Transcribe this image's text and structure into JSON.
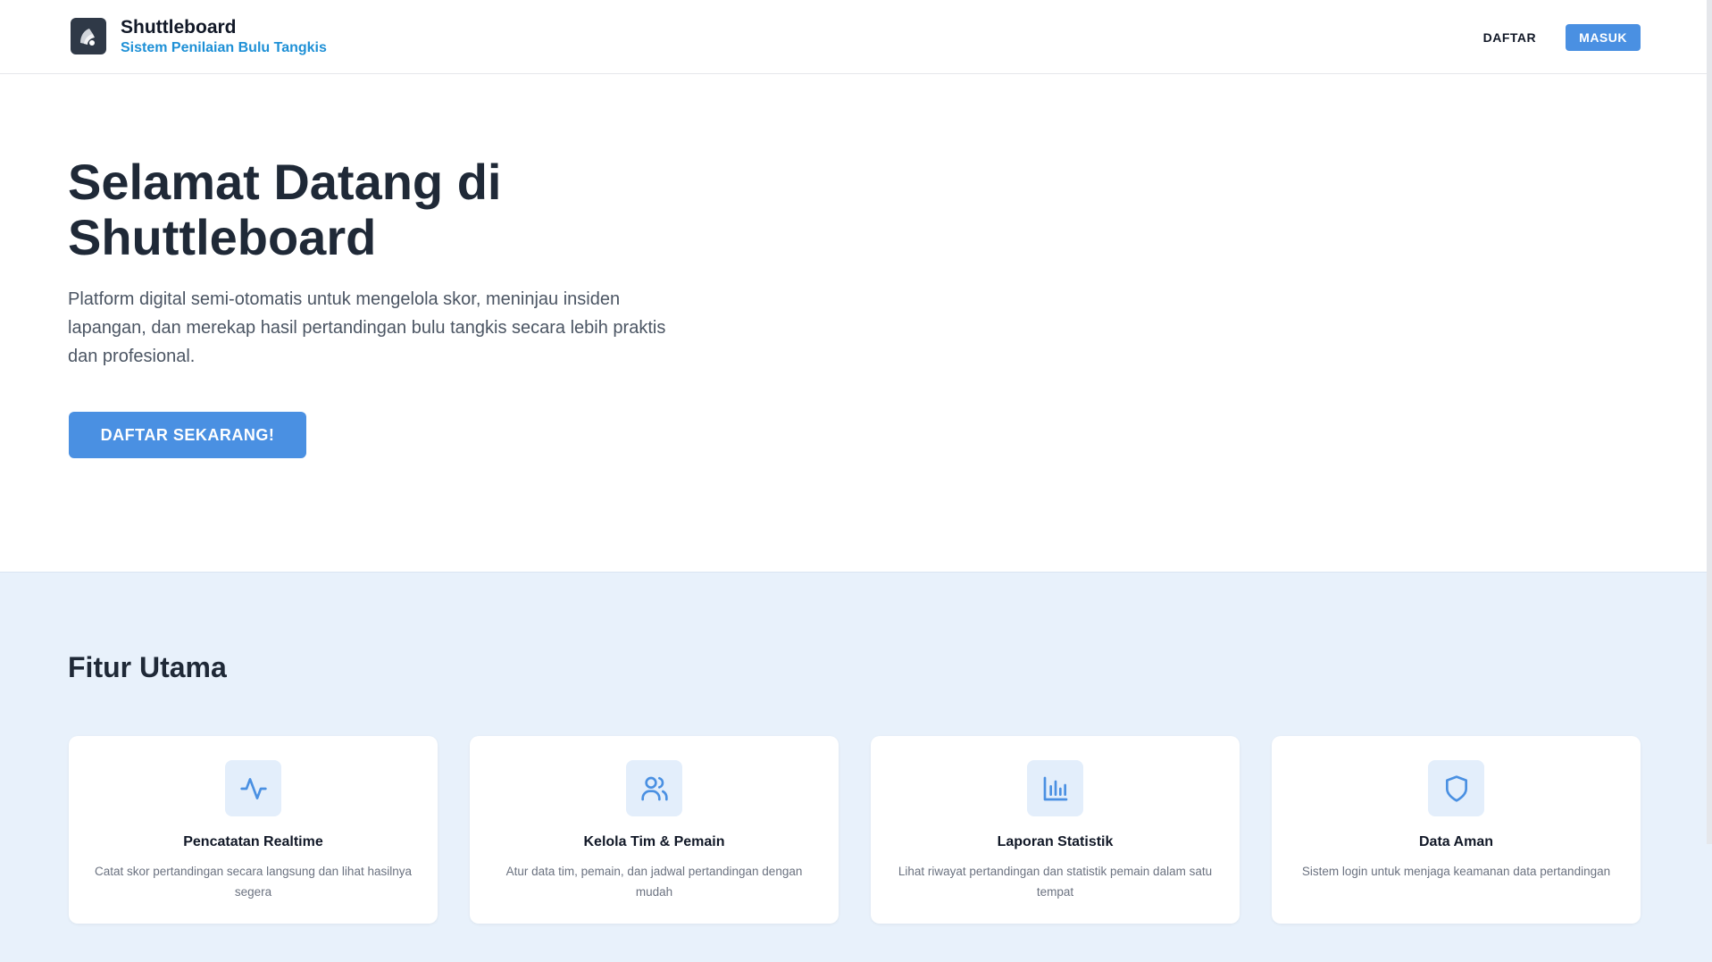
{
  "brand": {
    "title": "Shuttleboard",
    "subtitle": "Sistem Penilaian Bulu Tangkis",
    "logo_icon": "shuttlecock-icon"
  },
  "nav": {
    "daftar_label": "DAFTAR",
    "masuk_label": "MASUK"
  },
  "hero": {
    "title": "Selamat Datang di Shuttleboard",
    "description": "Platform digital semi-otomatis untuk mengelola skor, meninjau insiden lapangan, dan merekap hasil pertandingan bulu tangkis secara lebih praktis dan profesional.",
    "cta_label": "DAFTAR SEKARANG!"
  },
  "features": {
    "title": "Fitur Utama",
    "items": [
      {
        "icon": "activity-icon",
        "title": "Pencatatan Realtime",
        "description": "Catat skor pertandingan secara langsung dan lihat hasilnya segera"
      },
      {
        "icon": "users-icon",
        "title": "Kelola Tim & Pemain",
        "description": "Atur data tim, pemain, dan jadwal pertandingan dengan mudah"
      },
      {
        "icon": "bar-chart-icon",
        "title": "Laporan Statistik",
        "description": "Lihat riwayat pertandingan dan statistik pemain dalam satu tempat"
      },
      {
        "icon": "shield-icon",
        "title": "Data Aman",
        "description": "Sistem login untuk menjaga keamanan data pertandingan"
      }
    ]
  },
  "colors": {
    "primary": "#4a90e2",
    "subtitle": "#1e90d6",
    "features_bg": "#e8f1fb",
    "heading": "#1f2937"
  }
}
